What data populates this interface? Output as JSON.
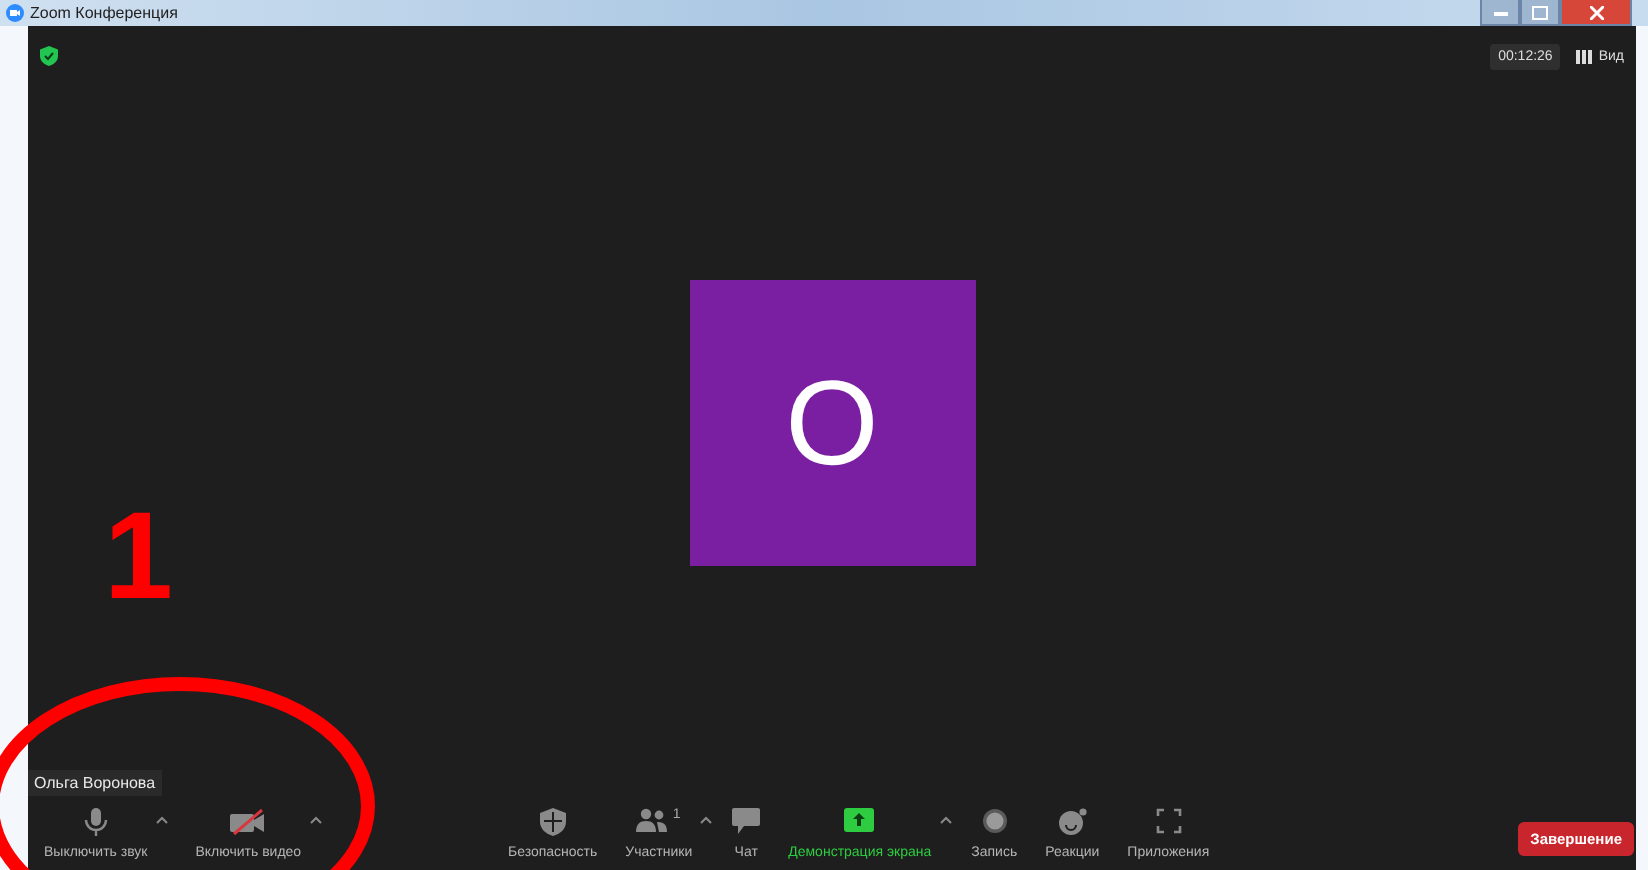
{
  "window": {
    "title": "Zoom Конференция"
  },
  "timer": "00:12:26",
  "view_button": "Вид",
  "participant": {
    "avatar_letter": "О",
    "name": "Ольга Воронова"
  },
  "annotation": {
    "number": "1"
  },
  "toolbar_left": [
    {
      "kind": "mic",
      "label": "Выключить звук",
      "caret": true
    },
    {
      "kind": "video-off",
      "label": "Включить видео",
      "caret": true
    }
  ],
  "toolbar_center": [
    {
      "kind": "security",
      "label": "Безопасность",
      "caret": false
    },
    {
      "kind": "participants",
      "label": "Участники",
      "count": "1",
      "caret": true
    },
    {
      "kind": "chat",
      "label": "Чат",
      "caret": false
    },
    {
      "kind": "share",
      "label": "Демонстрация экрана",
      "caret": true,
      "highlighted": true
    },
    {
      "kind": "record",
      "label": "Запись",
      "caret": false
    },
    {
      "kind": "reactions",
      "label": "Реакции",
      "caret": false
    },
    {
      "kind": "apps",
      "label": "Приложения",
      "caret": false
    }
  ],
  "end_button": "Завершение"
}
